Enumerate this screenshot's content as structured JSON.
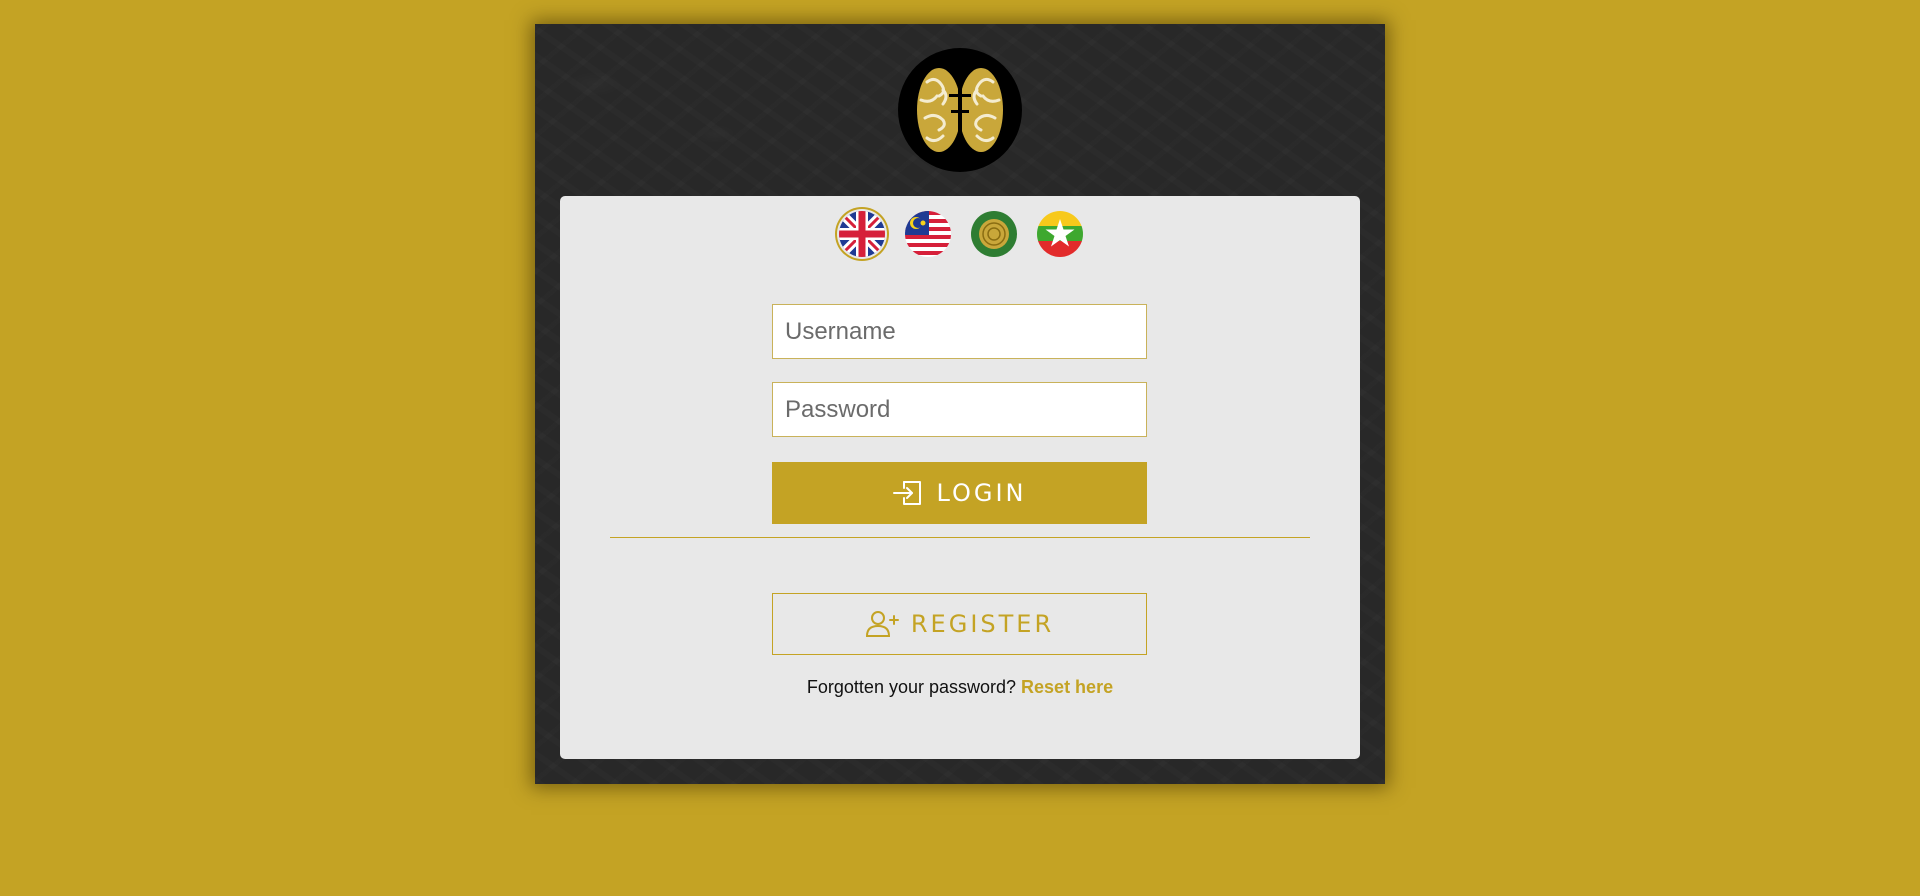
{
  "colors": {
    "page_background": "#c4a324",
    "panel_background": "#282828",
    "card_background": "#e8e8e8",
    "accent": "#c4a324"
  },
  "logo": {
    "icon": "brain-logo-icon"
  },
  "languages": [
    {
      "icon": "uk-flag-icon",
      "selected": true
    },
    {
      "icon": "malaysia-flag-icon",
      "selected": false
    },
    {
      "icon": "arabic-emblem-flag-icon",
      "selected": false
    },
    {
      "icon": "myanmar-flag-icon",
      "selected": false
    }
  ],
  "form": {
    "username_placeholder": "Username",
    "password_placeholder": "Password",
    "login_label": "LOGIN",
    "login_icon": "login-icon",
    "register_label": "REGISTER",
    "register_icon": "add-user-icon",
    "forgot_text": "Forgotten your password?",
    "reset_link": "Reset here"
  }
}
